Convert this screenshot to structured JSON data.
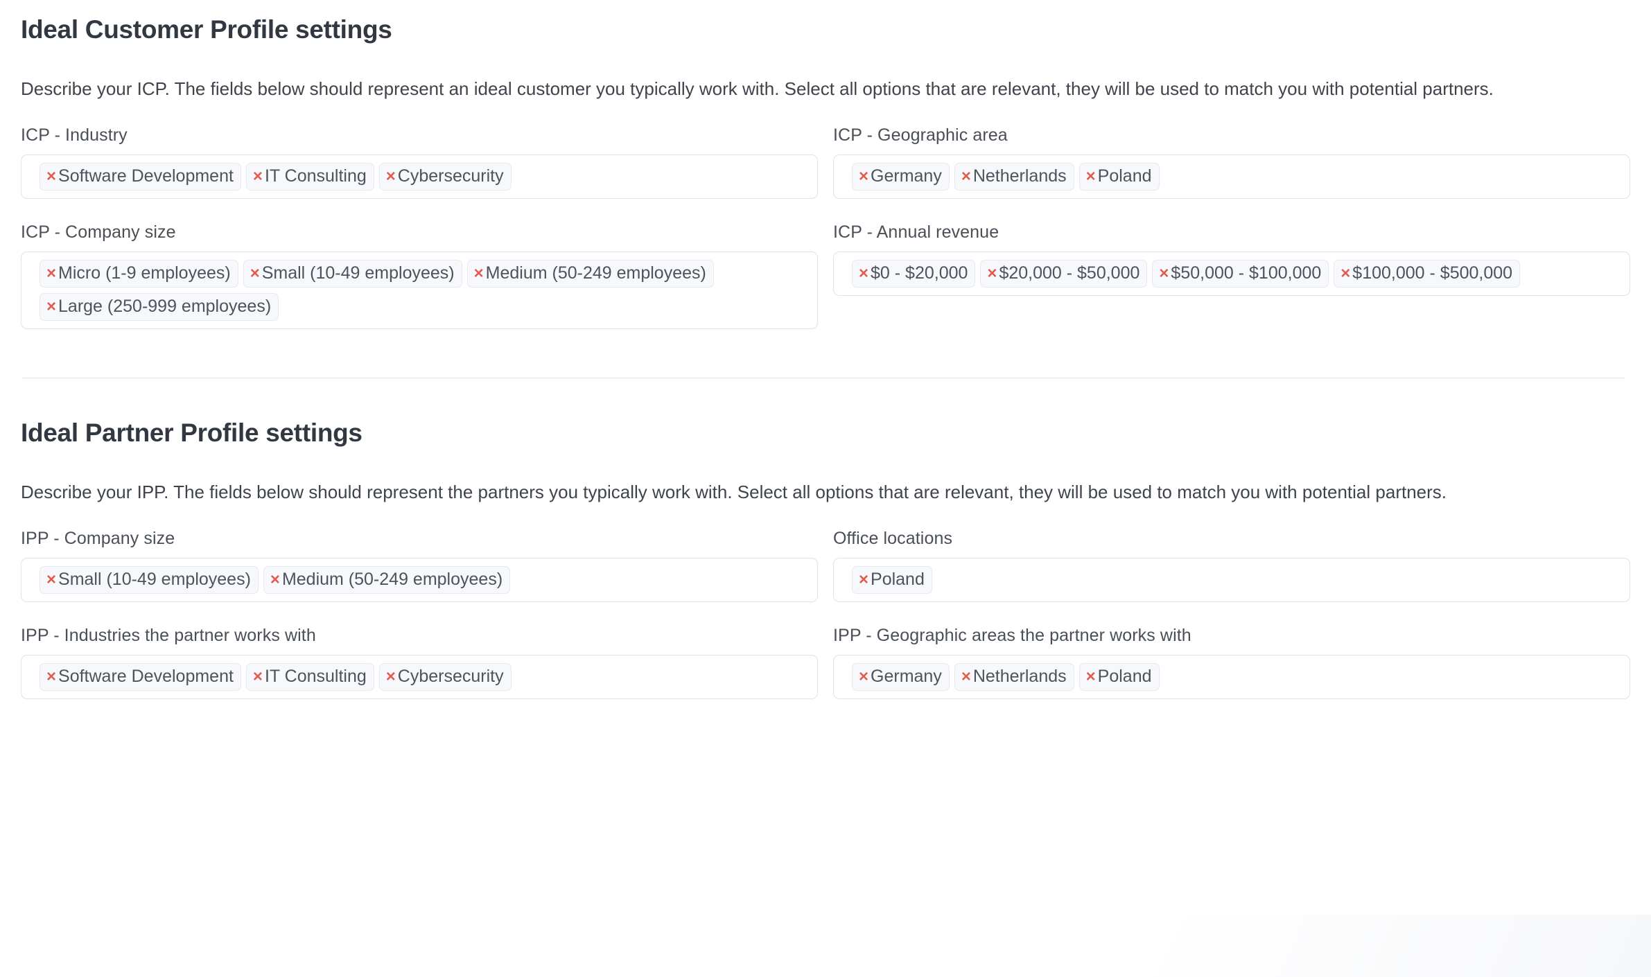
{
  "icp": {
    "title": "Ideal Customer Profile settings",
    "description": "Describe your ICP. The fields below should represent an ideal customer you typically work with. Select all options that are relevant, they will be used to match you with potential partners.",
    "fields": [
      {
        "label": "ICP - Industry",
        "tags": [
          "Software Development",
          "IT Consulting",
          "Cybersecurity"
        ]
      },
      {
        "label": "ICP - Geographic area",
        "tags": [
          "Germany",
          "Netherlands",
          "Poland"
        ]
      },
      {
        "label": "ICP - Company size",
        "tags": [
          "Micro (1-9 employees)",
          "Small (10-49 employees)",
          "Medium (50-249 employees)",
          "Large (250-999 employees)"
        ]
      },
      {
        "label": "ICP - Annual revenue",
        "tags": [
          "$0 - $20,000",
          "$20,000 - $50,000",
          "$50,000 - $100,000",
          "$100,000 - $500,000"
        ]
      }
    ]
  },
  "ipp": {
    "title": "Ideal Partner Profile settings",
    "description": "Describe your IPP. The fields below should represent the partners you typically work with. Select all options that are relevant, they will be used to match you with potential partners.",
    "fields": [
      {
        "label": "IPP - Company size",
        "tags": [
          "Small (10-49 employees)",
          "Medium (50-249 employees)"
        ]
      },
      {
        "label": "Office locations",
        "tags": [
          "Poland"
        ]
      },
      {
        "label": "IPP - Industries the partner works with",
        "tags": [
          "Software Development",
          "IT Consulting",
          "Cybersecurity"
        ]
      },
      {
        "label": "IPP - Geographic areas the partner works with",
        "tags": [
          "Germany",
          "Netherlands",
          "Poland"
        ]
      }
    ]
  },
  "icons": {
    "remove": "remove-tag-icon",
    "remove_glyph": "×"
  },
  "colors": {
    "remove_icon": "#e25b4d",
    "tag_background": "#f7f8fc",
    "tag_border": "#e6e9f0",
    "field_border": "#dfe2e9",
    "heading_text": "#313841",
    "body_text": "#3f444c"
  }
}
